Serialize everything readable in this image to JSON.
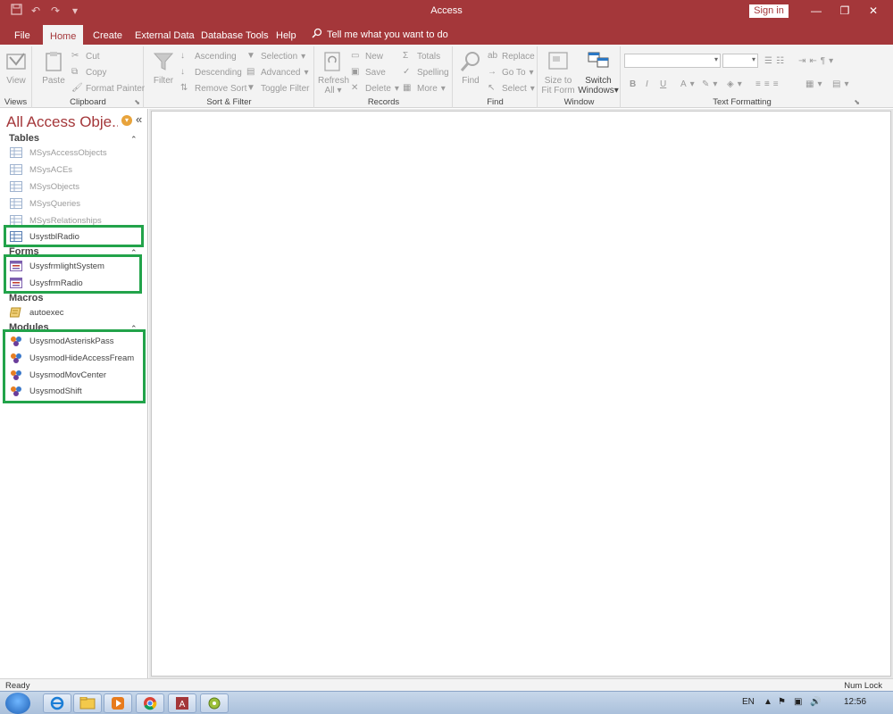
{
  "window": {
    "title": "Access",
    "sign_in": "Sign in",
    "qat": {
      "save_icon": "save-icon",
      "undo_icon": "undo-icon",
      "redo_icon": "redo-icon",
      "customize": "▾"
    },
    "controls": {
      "minimize": "—",
      "restore": "❐",
      "close": "✕"
    }
  },
  "tabs": [
    "File",
    "Home",
    "Create",
    "External Data",
    "Database Tools",
    "Help"
  ],
  "active_tab": "Home",
  "tell_me": "Tell me what you want to do",
  "ribbon": {
    "views": {
      "view": "View",
      "label": "Views"
    },
    "clipboard": {
      "paste": "Paste",
      "cut": "Cut",
      "copy": "Copy",
      "format_painter": "Format Painter",
      "label": "Clipboard"
    },
    "sort_filter": {
      "filter": "Filter",
      "ascending": "Ascending",
      "descending": "Descending",
      "remove_sort": "Remove Sort",
      "selection": "Selection",
      "advanced": "Advanced",
      "toggle_filter": "Toggle Filter",
      "label": "Sort & Filter"
    },
    "records": {
      "refresh": "Refresh",
      "refresh_all": "All",
      "new": "New",
      "save": "Save",
      "delete": "Delete",
      "totals": "Totals",
      "spelling": "Spelling",
      "more": "More",
      "label": "Records"
    },
    "find": {
      "find": "Find",
      "replace": "Replace",
      "go_to": "Go To",
      "select": "Select",
      "label": "Find"
    },
    "window": {
      "size_to": "Size to",
      "fit_form": "Fit Form",
      "switch": "Switch",
      "windows": "Windows",
      "label": "Window"
    },
    "text_formatting": {
      "bold": "B",
      "italic": "I",
      "underline": "U",
      "font_color": "A",
      "label": "Text Formatting"
    }
  },
  "nav": {
    "title": "All Access Obje...",
    "sections": [
      {
        "name": "Tables",
        "items": [
          {
            "label": "MSysAccessObjects",
            "system": true
          },
          {
            "label": "MSysACEs",
            "system": true
          },
          {
            "label": "MSysObjects",
            "system": true
          },
          {
            "label": "MSysQueries",
            "system": true
          },
          {
            "label": "MSysRelationships",
            "system": true
          },
          {
            "label": "UsystblRadio",
            "system": false
          }
        ]
      },
      {
        "name": "Forms",
        "items": [
          {
            "label": "UsysfrmlightSystem"
          },
          {
            "label": "UsysfrmRadio"
          }
        ]
      },
      {
        "name": "Macros",
        "items": [
          {
            "label": "autoexec"
          }
        ]
      },
      {
        "name": "Modules",
        "items": [
          {
            "label": "UsysmodAsteriskPass"
          },
          {
            "label": "UsysmodHideAccessFream"
          },
          {
            "label": "UsysmodMovCenter"
          },
          {
            "label": "UsysmodShift"
          }
        ]
      }
    ]
  },
  "status": {
    "left": "Ready",
    "right": "Num Lock"
  },
  "taskbar": {
    "apps": [
      "ie-icon",
      "explorer-icon",
      "media-player-icon",
      "chrome-icon",
      "access-icon",
      "tool-icon"
    ],
    "lang": "EN",
    "time": "12:56"
  },
  "colors": {
    "accent": "#a4373a",
    "highlight": "#22a34a"
  }
}
